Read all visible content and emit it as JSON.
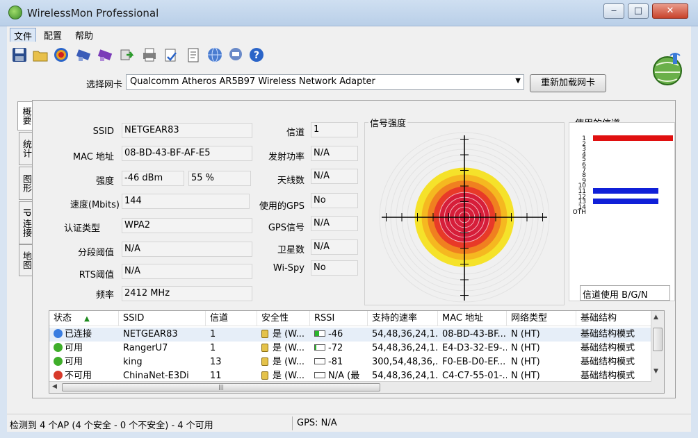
{
  "window": {
    "title": "WirelessMon Professional",
    "min": "‒",
    "max": "□",
    "close": "✕"
  },
  "menu": [
    "文件",
    "配置",
    "帮助"
  ],
  "toolbar": [
    "save-icon",
    "open-folder-icon",
    "target-icon",
    "network-card-icon",
    "network-card-alt-icon",
    "export-icon",
    "print-icon",
    "print-setup-icon",
    "report-icon",
    "globe-icon",
    "chat-icon",
    "help-icon"
  ],
  "adapter": {
    "label": "选择网卡",
    "value": "Qualcomm Atheros AR5B97 Wireless Network Adapter",
    "reload": "重新加载网卡"
  },
  "tabs": [
    "概要",
    "统计",
    "图形",
    "IP 连接",
    "地图"
  ],
  "summary": {
    "ssid_label": "SSID",
    "ssid": "NETGEAR83",
    "mac_label": "MAC 地址",
    "mac": "08-BD-43-BF-AF-E5",
    "strength_label": "强度",
    "strength_dbm": "-46 dBm",
    "strength_pct": "55 %",
    "speed_label": "速度(Mbits)",
    "speed": "144",
    "auth_label": "认证类型",
    "auth": "WPA2",
    "frag_label": "分段阈值",
    "frag": "N/A",
    "rts_label": "RTS阈值",
    "rts": "N/A",
    "freq_label": "频率",
    "freq": "2412 MHz",
    "channel_label": "信道",
    "channel": "1",
    "txpower_label": "发射功率",
    "txpower": "N/A",
    "antenna_label": "天线数",
    "antenna": "N/A",
    "gps_used_label": "使用的GPS",
    "gps_used": "No",
    "gps_signal_label": "GPS信号",
    "gps_signal": "N/A",
    "satellites_label": "卫星数",
    "satellites": "N/A",
    "wispy_label": "Wi-Spy",
    "wispy": "No"
  },
  "signal": {
    "title": "信号强度",
    "strength_pct": 55
  },
  "channels": {
    "title": "使用的信道",
    "labels": [
      "1",
      "2",
      "3",
      "4",
      "5",
      "6",
      "7",
      "8",
      "9",
      "10",
      "11",
      "12",
      "13",
      "14",
      "OTH"
    ],
    "usage": [
      {
        "channel": "1",
        "color": "#e01010"
      },
      {
        "channel": "11",
        "color": "#1020d8"
      },
      {
        "channel": "13",
        "color": "#1020d8"
      }
    ],
    "mode": "信道使用 B/G/N"
  },
  "table": {
    "headers": [
      "状态",
      "SSID",
      "信道",
      "安全性",
      "RSSI",
      "支持的速率",
      "MAC 地址",
      "网络类型",
      "基础结构"
    ],
    "rows": [
      {
        "status": "已连接",
        "dot": "#3a7de0",
        "ssid": "NETGEAR83",
        "channel": "1",
        "security": "是 (W...",
        "rssi": "-46",
        "rssi_fill": 0.8,
        "rates": "54,48,36,24,1...",
        "mac": "08-BD-43-BF...",
        "type": "N (HT)",
        "infra": "基础结构模式"
      },
      {
        "status": "可用",
        "dot": "#3fae2a",
        "ssid": "RangerU7",
        "channel": "1",
        "security": "是 (W...",
        "rssi": "-72",
        "rssi_fill": 0.35,
        "rates": "54,48,36,24,1...",
        "mac": "E4-D3-32-E9-...",
        "type": "N (HT)",
        "infra": "基础结构模式"
      },
      {
        "status": "可用",
        "dot": "#3fae2a",
        "ssid": "king",
        "channel": "13",
        "security": "是 (W...",
        "rssi": "-81",
        "rssi_fill": 0.0,
        "rates": "300,54,48,36,...",
        "mac": "F0-EB-D0-EF...",
        "type": "N (HT)",
        "infra": "基础结构模式"
      },
      {
        "status": "不可用",
        "dot": "#d83a2a",
        "ssid": "ChinaNet-E3Di",
        "channel": "11",
        "security": "是 (W...",
        "rssi": "N/A (最",
        "rssi_fill": 0.0,
        "rates": "54,48,36,24,1...",
        "mac": "C4-C7-55-01-...",
        "type": "N (HT)",
        "infra": "基础结构模式"
      }
    ],
    "hscroll_grip": "|||"
  },
  "statusbar": {
    "left": "检测到 4 个AP (4 个安全 - 0 个不安全) - 4 个可用",
    "right": "GPS: N/A"
  }
}
